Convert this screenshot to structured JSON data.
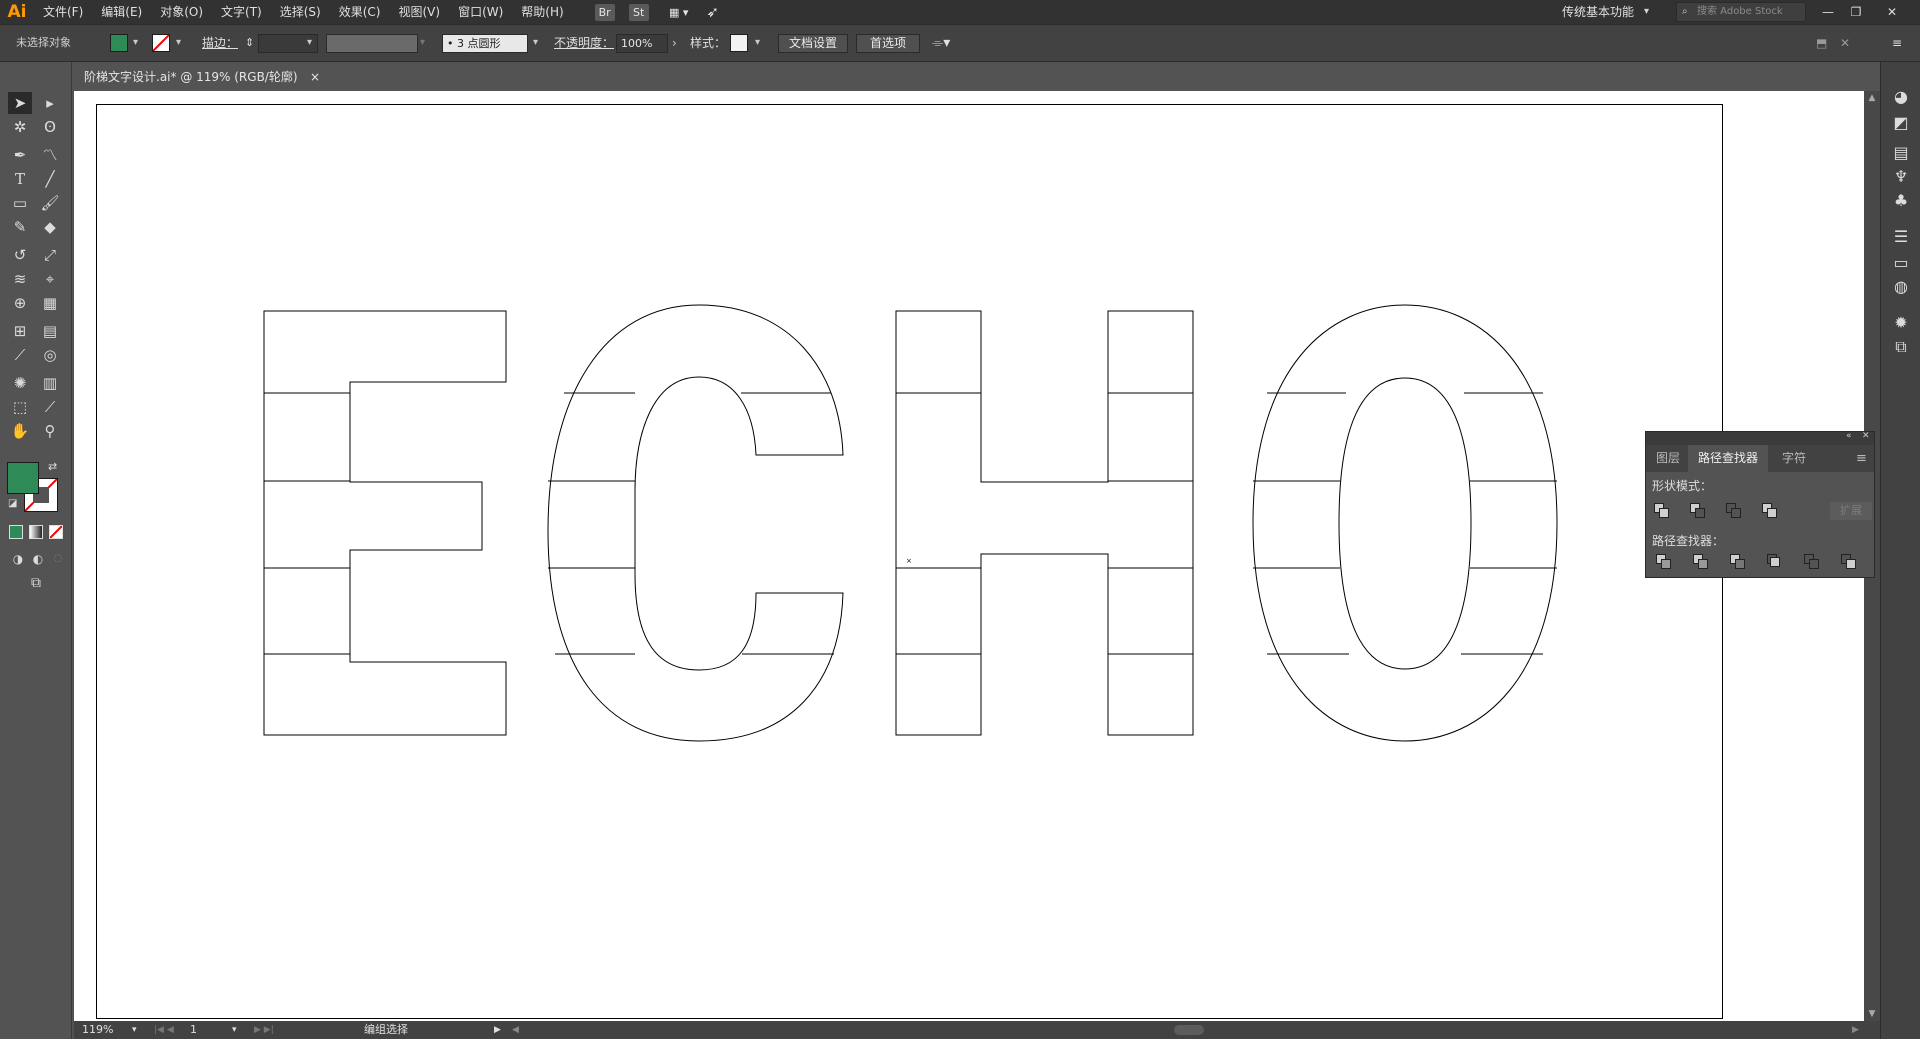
{
  "app": {
    "logo": "Ai"
  },
  "menu": [
    "文件(F)",
    "编辑(E)",
    "对象(O)",
    "文字(T)",
    "选择(S)",
    "效果(C)",
    "视图(V)",
    "窗口(W)",
    "帮助(H)"
  ],
  "menubar_icons": {
    "bridge": "Br",
    "stock": "St",
    "arrange": "▦ ▾",
    "gpu": "➶"
  },
  "workspace": {
    "label": "传统基本功能",
    "chevron": "▾"
  },
  "stock_search": {
    "placeholder": "搜索 Adobe Stock"
  },
  "window_buttons": [
    "—",
    "❐",
    "✕"
  ],
  "control_bar": {
    "selection_status": "未选择对象",
    "fill_color": "#2e8b57",
    "stroke_label": "描边：",
    "stroke_weight": "",
    "brush_value": "",
    "brush_profile": "• 3 点圆形",
    "opacity_label": "不透明度：",
    "opacity_value": "100%",
    "style_label": "样式：",
    "doc_setup_button": "文档设置",
    "preferences_button": "首选项"
  },
  "document_tab": {
    "title": "阶梯文字设计.ai* @ 119% (RGB/轮廓)",
    "close": "×"
  },
  "artwork": {
    "text": "ECHO",
    "mode": "outline",
    "bands": 5
  },
  "tools": {
    "fill_color": "#2e8b57",
    "items": [
      "selection",
      "direct-selection",
      "magic-wand",
      "lasso",
      "pen",
      "curvature",
      "type",
      "line",
      "rectangle",
      "paintbrush",
      "shaper",
      "eraser",
      "rotate",
      "scale",
      "warp",
      "free-transform",
      "shape-builder",
      "perspective-grid",
      "mesh",
      "gradient",
      "eyedropper",
      "blend",
      "symbol-sprayer",
      "column-graph",
      "artboard",
      "slice",
      "hand",
      "zoom"
    ]
  },
  "pathfinder_panel": {
    "tabs": [
      "图层",
      "路径查找器",
      "字符"
    ],
    "active_tab": "路径查找器",
    "shape_modes_label": "形状模式：",
    "pathfinders_label": "路径查找器：",
    "expand_button": "扩展"
  },
  "status_bar": {
    "zoom": "119%",
    "artboard_number": "1",
    "tool_status": "编组选择"
  }
}
